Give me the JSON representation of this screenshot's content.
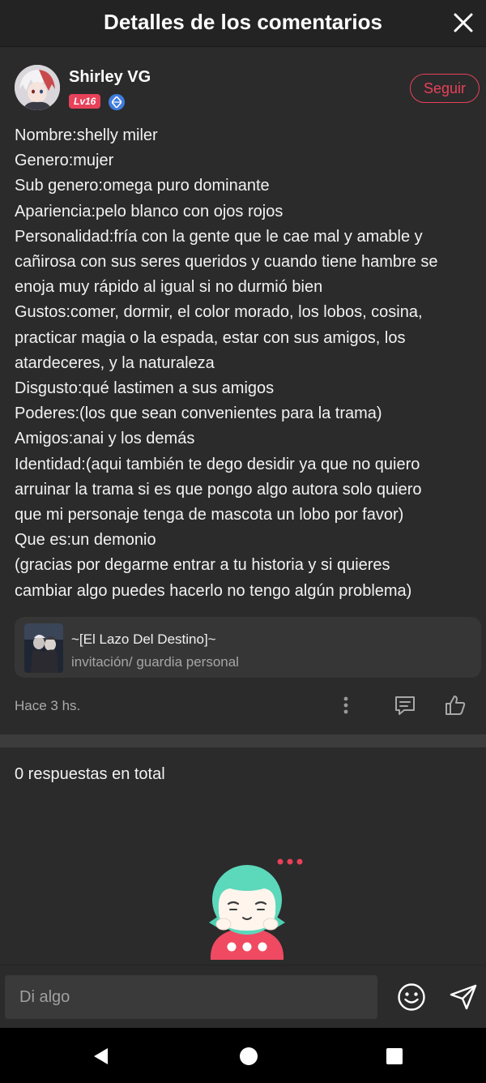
{
  "header": {
    "title": "Detalles de los comentarios"
  },
  "author": {
    "name": "Shirley VG",
    "level": "Lv16",
    "follow_label": "Seguir"
  },
  "comment": {
    "lines": [
      "Nombre:shelly miler",
      "Genero:mujer",
      "Sub genero:omega puro dominante",
      "Apariencia:pelo blanco con ojos rojos",
      "Personalidad:fría con la gente que le cae mal y amable y",
      "cañirosa con sus seres queridos y cuando tiene hambre se",
      "enoja muy rápido al igual si no durmió bien",
      "Gustos:comer, dormir, el color morado, los lobos, cosina,",
      "practicar magia o la espada, estar con sus amigos, los",
      "atardeceres, y la naturaleza",
      "Disgusto:qué lastimen a sus amigos",
      "Poderes:(los que sean convenientes para la trama)",
      "Amigos:anai y los demás",
      "Identidad:(aqui también te dego desidir ya que no quiero",
      "arruinar la trama si es que pongo algo autora solo quiero",
      "que mi personaje tenga de mascota un lobo por favor)",
      "Que es:un demonio",
      "(gracias por degarme entrar a tu historia y si quieres",
      "cambiar algo puedes hacerlo no tengo algún problema)"
    ]
  },
  "story": {
    "title": "~[El Lazo Del Destino]~",
    "subtitle": "invitación/ guardia personal"
  },
  "meta": {
    "time": "Hace 3 hs."
  },
  "replies": {
    "count_label": "0 respuestas en total"
  },
  "input": {
    "placeholder": "Di algo"
  },
  "colors": {
    "accent": "#e8415a",
    "background": "#2b2b2b",
    "verified": "#3f7de0"
  },
  "icons": {
    "close": "close-icon",
    "verified": "verified-icon",
    "more": "more-vertical-icon",
    "reply": "comment-icon",
    "like": "thumbs-up-icon",
    "emoji": "smiley-icon",
    "send": "send-icon",
    "nav_back": "back-triangle-icon",
    "nav_home": "home-circle-icon",
    "nav_recent": "recent-square-icon"
  }
}
